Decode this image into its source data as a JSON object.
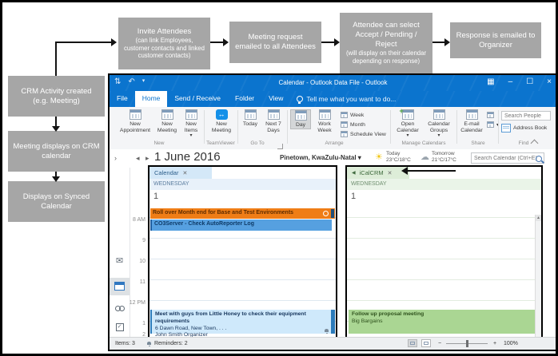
{
  "flowchart": {
    "invite": {
      "title": "Invite Attendees",
      "detail": "(can link Employees, customer contacts and linked customer contacts)"
    },
    "request": {
      "title": "Meeting request emailed to all Attendees"
    },
    "select": {
      "title": "Attendee can select Accept / Pending / Reject",
      "detail": "(will display on their calendar depending on response)"
    },
    "response": {
      "title": "Response is emailed to Organizer"
    },
    "crm_created": {
      "title": "CRM Activity created (e.g. Meeting)"
    },
    "crm_displays": {
      "title": "Meeting displays on CRM calendar"
    },
    "synced": {
      "title": "Displays on Synced Calendar"
    }
  },
  "outlook": {
    "title": "Calendar - Outlook Data File - Outlook",
    "tabs": [
      "File",
      "Home",
      "Send / Receive",
      "Folder",
      "View"
    ],
    "tell_me": "Tell me what you want to do...",
    "ribbon": {
      "new_appointment": "New Appointment",
      "new_meeting": "New Meeting",
      "new_items": "New Items",
      "tv_new_meeting": "New Meeting",
      "today": "Today",
      "next7": "Next 7 Days",
      "day": "Day",
      "work_week": "Work Week",
      "week": "Week",
      "month": "Month",
      "schedule_view": "Schedule View",
      "open_calendar": "Open Calendar",
      "calendar_groups": "Calendar Groups",
      "email_calendar": "E-mail Calendar",
      "search_people": "Search People",
      "address_book": "Address Book",
      "groups": [
        "New",
        "TeamViewer",
        "Go To",
        "Arrange",
        "Manage Calendars",
        "Share",
        "Find"
      ]
    },
    "header": {
      "date": "1 June 2016",
      "location": "Pinetown, KwaZulu-Natal",
      "today_label": "Today",
      "today_temp": "23°C/18°C",
      "tomorrow_label": "Tomorrow",
      "tomorrow_temp": "21°C/17°C",
      "search_placeholder": "Search Calendar (Ctrl+E)"
    },
    "time_labels": [
      "8 AM",
      "9",
      "10",
      "11",
      "12 PM",
      "1",
      "2"
    ],
    "left_pane": {
      "tab": "Calendar",
      "day": "WEDNESDAY",
      "date": "1",
      "allday_event": "Roll over Month end for Base and Test Environments",
      "morning_event": "CO3Server - Check AutoReporter Log",
      "meeting_title": "Meet with guys from Little Honey to check their equipment requirements",
      "meeting_location": "6 Dawn Road, New Town, . . .",
      "meeting_organizer": "John Smith Organizer"
    },
    "right_pane": {
      "tab": "iCalCRM",
      "day": "WEDNESDAY",
      "date": "1",
      "meeting_title": "Follow up proposal meeting",
      "meeting_company": "Big Bargains"
    },
    "status": {
      "items": "Items: 3",
      "reminders": "Reminders: 2",
      "zoom": "100%"
    }
  }
}
